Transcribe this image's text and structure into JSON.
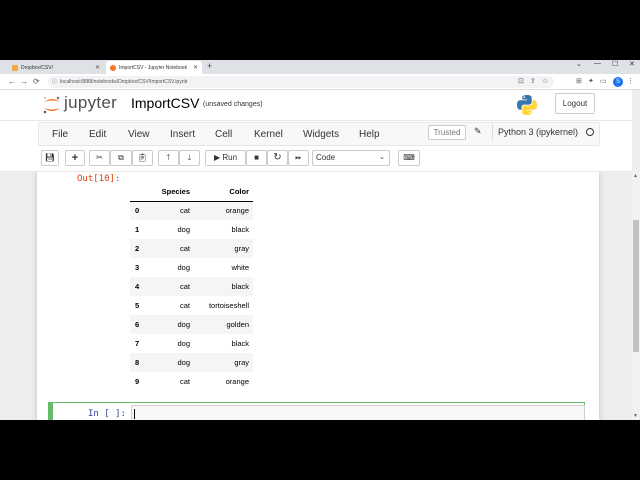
{
  "browser": {
    "tabs": [
      {
        "label": "Dropbox/CSV/"
      },
      {
        "label": "ImportCSV - Jupyter Notebook"
      }
    ],
    "url": "localhost:8888/notebooks/Dropbox/CSV/ImportCSV.ipynb",
    "profile_initial": "S"
  },
  "header": {
    "logo_text": "jupyter",
    "notebook_name": "ImportCSV",
    "save_status": "(unsaved changes)",
    "logout_label": "Logout"
  },
  "menubar": {
    "items": [
      "File",
      "Edit",
      "View",
      "Insert",
      "Cell",
      "Kernel",
      "Widgets",
      "Help"
    ],
    "trusted_label": "Trusted",
    "kernel_name": "Python 3 (ipykernel)"
  },
  "toolbar": {
    "run_label": "Run",
    "cell_type": "Code"
  },
  "output": {
    "prompt": "Out[10]:",
    "columns": [
      "Species",
      "Color"
    ],
    "rows": [
      {
        "index": "0",
        "species": "cat",
        "color": "orange"
      },
      {
        "index": "1",
        "species": "dog",
        "color": "black"
      },
      {
        "index": "2",
        "species": "cat",
        "color": "gray"
      },
      {
        "index": "3",
        "species": "dog",
        "color": "white"
      },
      {
        "index": "4",
        "species": "cat",
        "color": "black"
      },
      {
        "index": "5",
        "species": "cat",
        "color": "tortoiseshell"
      },
      {
        "index": "6",
        "species": "dog",
        "color": "golden"
      },
      {
        "index": "7",
        "species": "dog",
        "color": "black"
      },
      {
        "index": "8",
        "species": "dog",
        "color": "gray"
      },
      {
        "index": "9",
        "species": "cat",
        "color": "orange"
      }
    ]
  },
  "input_cell": {
    "prompt": "In [ ]:"
  },
  "colors": {
    "jupyter_orange": "#f37726",
    "out_prompt": "#d84315",
    "in_prompt": "#303f9f",
    "active_cell_border": "#66bb6a"
  }
}
